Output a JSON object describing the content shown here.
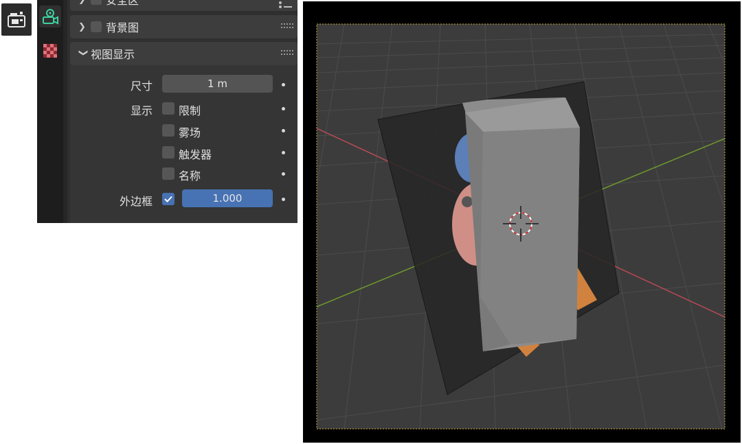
{
  "camera_tool": {
    "icon": "camera-icon"
  },
  "tabs": [
    {
      "name": "scene-tab",
      "icon": "camera-object-icon",
      "active": true,
      "color": "#3fd0a0"
    },
    {
      "name": "texture-tab",
      "icon": "checker-texture-icon",
      "active": false,
      "color": "#d9606a"
    }
  ],
  "sections": {
    "safe_area": {
      "label": "安全区",
      "collapsed": true
    },
    "background": {
      "label": "背景图",
      "collapsed": true,
      "enabled": false
    },
    "viewport_display": {
      "label": "视图显示",
      "collapsed": false
    }
  },
  "viewport_display": {
    "size_label": "尺寸",
    "size_value": "1 m",
    "show_label": "显示",
    "show_options": [
      {
        "label": "限制",
        "checked": false
      },
      {
        "label": "雾场",
        "checked": false
      },
      {
        "label": "触发器",
        "checked": false
      },
      {
        "label": "名称",
        "checked": false
      }
    ],
    "passepartout_label": "外边框",
    "passepartout_enabled": true,
    "passepartout_value": "1.000"
  },
  "colors": {
    "accent": "#4772b3",
    "axis_x": "#b94a55",
    "axis_y": "#6f9a2e",
    "camera_frame": "#c9a73a"
  }
}
